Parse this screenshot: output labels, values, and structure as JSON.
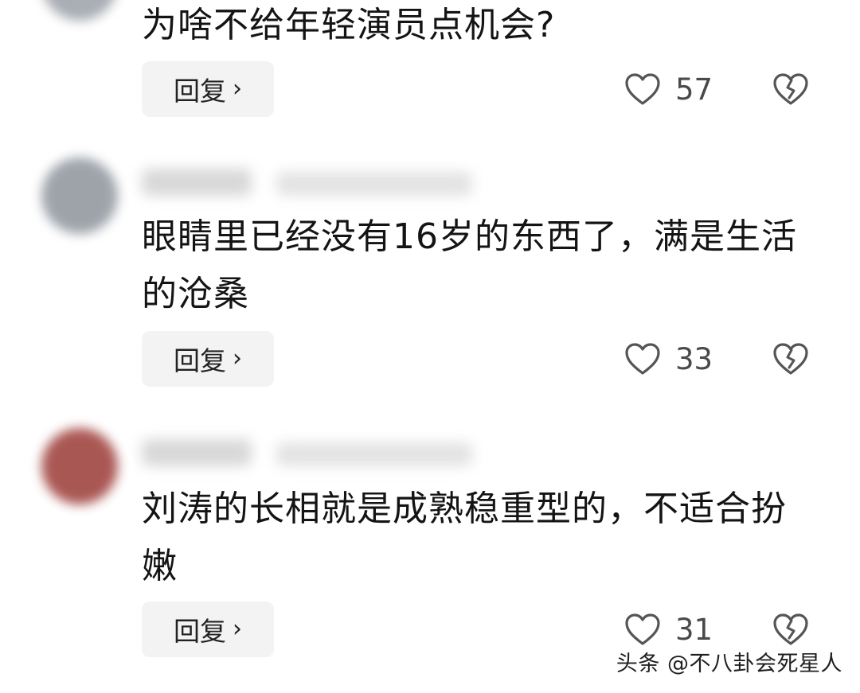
{
  "comments": [
    {
      "text": "为啥不给年轻演员点机会?",
      "reply_label": "回复",
      "reply_chevron": "›",
      "likes": "57",
      "avatar_color": "#9aa0a8",
      "icons": {
        "like": "heart-outline-icon",
        "dislike": "broken-heart-icon"
      }
    },
    {
      "text": "眼睛里已经没有16岁的东西了，满是生活的沧桑",
      "reply_label": "回复",
      "reply_chevron": "›",
      "likes": "33",
      "avatar_color": "#8e949c",
      "icons": {
        "like": "heart-outline-icon",
        "dislike": "broken-heart-icon"
      }
    },
    {
      "text": "刘涛的长相就是成熟稳重型的，不适合扮嫩",
      "reply_label": "回复",
      "reply_chevron": "›",
      "likes": "31",
      "avatar_color": "#9b3a36",
      "icons": {
        "like": "heart-outline-icon",
        "dislike": "broken-heart-icon"
      }
    }
  ],
  "watermark": "头条 @不八卦会死星人"
}
